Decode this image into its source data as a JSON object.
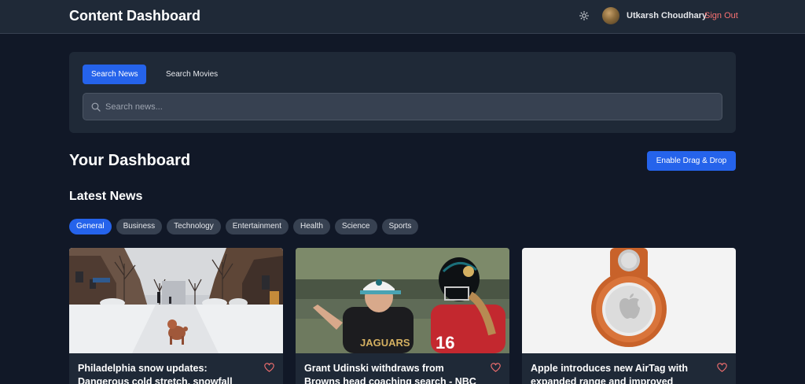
{
  "header": {
    "title": "Content Dashboard",
    "theme_icon": "sun-icon",
    "user_name": "Utkarsh Choudhary",
    "sign_out": "Sign Out"
  },
  "search": {
    "tabs": [
      {
        "label": "Search News",
        "active": true
      },
      {
        "label": "Search Movies",
        "active": false
      }
    ],
    "placeholder": "Search news..."
  },
  "dashboard": {
    "title": "Your Dashboard",
    "drag_drop_button": "Enable Drag & Drop"
  },
  "news": {
    "section_title": "Latest News",
    "categories": [
      "General",
      "Business",
      "Technology",
      "Entertainment",
      "Health",
      "Science",
      "Sports"
    ],
    "active_category": "General",
    "cards": [
      {
        "title": "Philadelphia snow updates: Dangerous cold stretch, snowfall",
        "image": "snowy-street-with-dog"
      },
      {
        "title": "Grant Udinski withdraws from Browns head coaching search - NBC Sports",
        "image": "football-coaches"
      },
      {
        "title": "Apple introduces new AirTag with expanded range and improved",
        "image": "airtag-keyring"
      }
    ]
  },
  "colors": {
    "background": "#111827",
    "surface": "#1f2937",
    "accent": "#2563eb",
    "danger": "#f87171"
  }
}
